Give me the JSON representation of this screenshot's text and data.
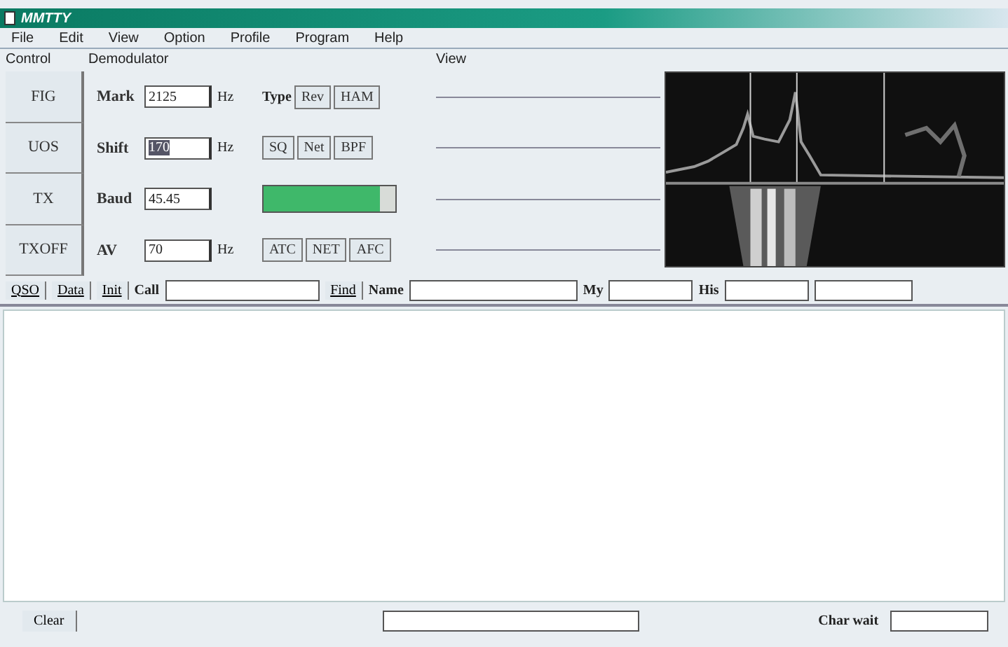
{
  "window": {
    "title": "MMTTY"
  },
  "menu": [
    "File",
    "Edit",
    "View",
    "Option",
    "Profile",
    "Program",
    "Help"
  ],
  "control": {
    "title": "Control",
    "buttons": [
      "FIG",
      "UOS",
      "TX",
      "TXOFF"
    ]
  },
  "demodulator": {
    "title": "Demodulator",
    "rows": [
      {
        "label": "Mark",
        "value": "2125",
        "unit": "Hz",
        "highlighted": false
      },
      {
        "label": "Shift",
        "value": "170",
        "unit": "Hz",
        "highlighted": true
      },
      {
        "label": "Baud",
        "value": "45.45",
        "highlighted": false
      },
      {
        "label": "AV",
        "value": "70",
        "unit": "Hz",
        "highlighted": false
      }
    ],
    "type_label": "Type",
    "type_buttons": [
      "Rev",
      "HAM"
    ],
    "filter_buttons": [
      "SQ",
      "Net",
      "BPF"
    ],
    "squelch": {
      "level": 0.88
    },
    "afc_buttons": [
      "ATC",
      "NET",
      "AFC"
    ]
  },
  "view": {
    "title": "View"
  },
  "qso": {
    "buttons": [
      "QSO",
      "Data",
      "Init"
    ],
    "call_label": "Call",
    "find": "Find",
    "name_label": "Name",
    "my_label": "My",
    "his_label": "His"
  },
  "bottom": {
    "buttons": [
      "Clear"
    ],
    "char_wait_label": "Char wait"
  }
}
